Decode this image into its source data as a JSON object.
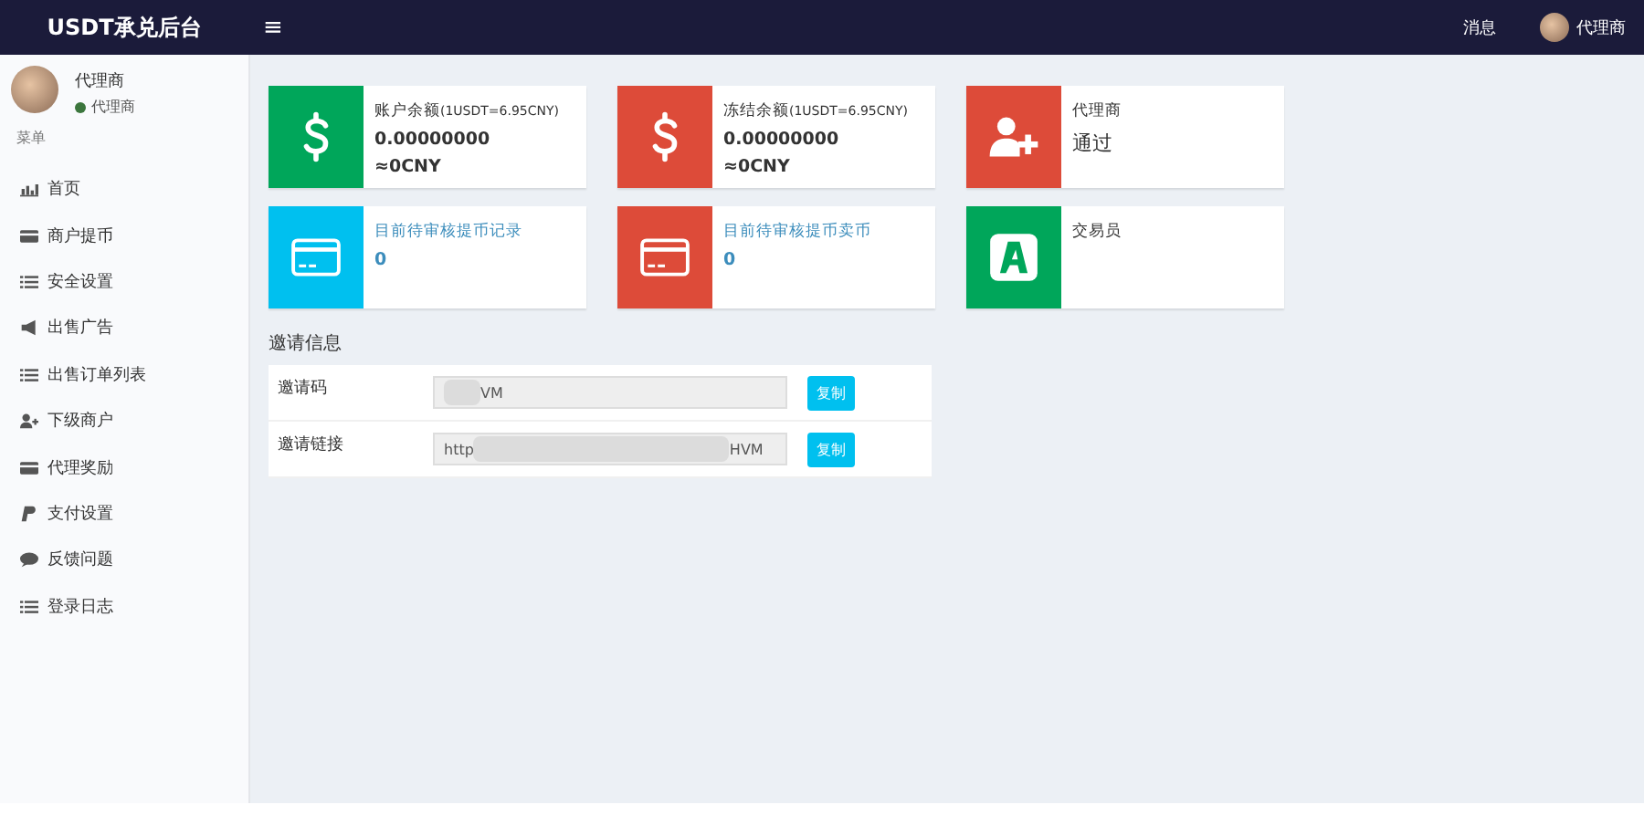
{
  "header": {
    "logo": "USDT承兑后台",
    "menu_toggle": "≡",
    "messages": "消息",
    "user": "代理商"
  },
  "sidebar": {
    "user": {
      "name": "代理商",
      "status": "代理商",
      "online": true
    },
    "section": "菜单",
    "items": [
      {
        "label": "首页",
        "selected": false
      },
      {
        "label": "商户提币",
        "selected": false
      },
      {
        "label": "安全设置",
        "selected": false
      },
      {
        "label": "出售广告",
        "selected": false
      },
      {
        "label": "出售订单列表",
        "selected": false
      },
      {
        "label": "下级商户",
        "selected": false
      },
      {
        "label": "代理奖励",
        "selected": false
      },
      {
        "label": "支付设置",
        "selected": false
      },
      {
        "label": "反馈问题",
        "selected": false
      },
      {
        "label": "登录日志",
        "selected": false
      }
    ]
  },
  "cards": [
    {
      "kind": "balance",
      "color": "#00a65a",
      "title": "账户余额",
      "rate": "(1USDT=6.95CNY)",
      "amount": "0.00000000",
      "cny": "≈0CNY"
    },
    {
      "kind": "balance",
      "color": "#dd4b39",
      "title": "冻结余额",
      "rate": "(1USDT=6.95CNY)",
      "amount": "0.00000000",
      "cny": "≈0CNY"
    },
    {
      "kind": "status",
      "color": "#dd4b39",
      "title": "代理商",
      "value": "通过"
    },
    {
      "kind": "link",
      "color": "#00c0ef",
      "title": "目前待审核提币记录",
      "value": "0"
    },
    {
      "kind": "link",
      "color": "#dd4b39",
      "title": "目前待审核提币卖币",
      "value": "0"
    },
    {
      "kind": "status",
      "color": "#00a65a",
      "title": "交易员"
    }
  ],
  "invite": {
    "title": "邀请信息",
    "rows": [
      {
        "label": "邀请码",
        "value_start": "",
        "value_end": "VM",
        "button": "复制"
      },
      {
        "label": "邀请链接",
        "value_start": "http",
        "value_end": "HVM",
        "button": "复制"
      }
    ]
  }
}
